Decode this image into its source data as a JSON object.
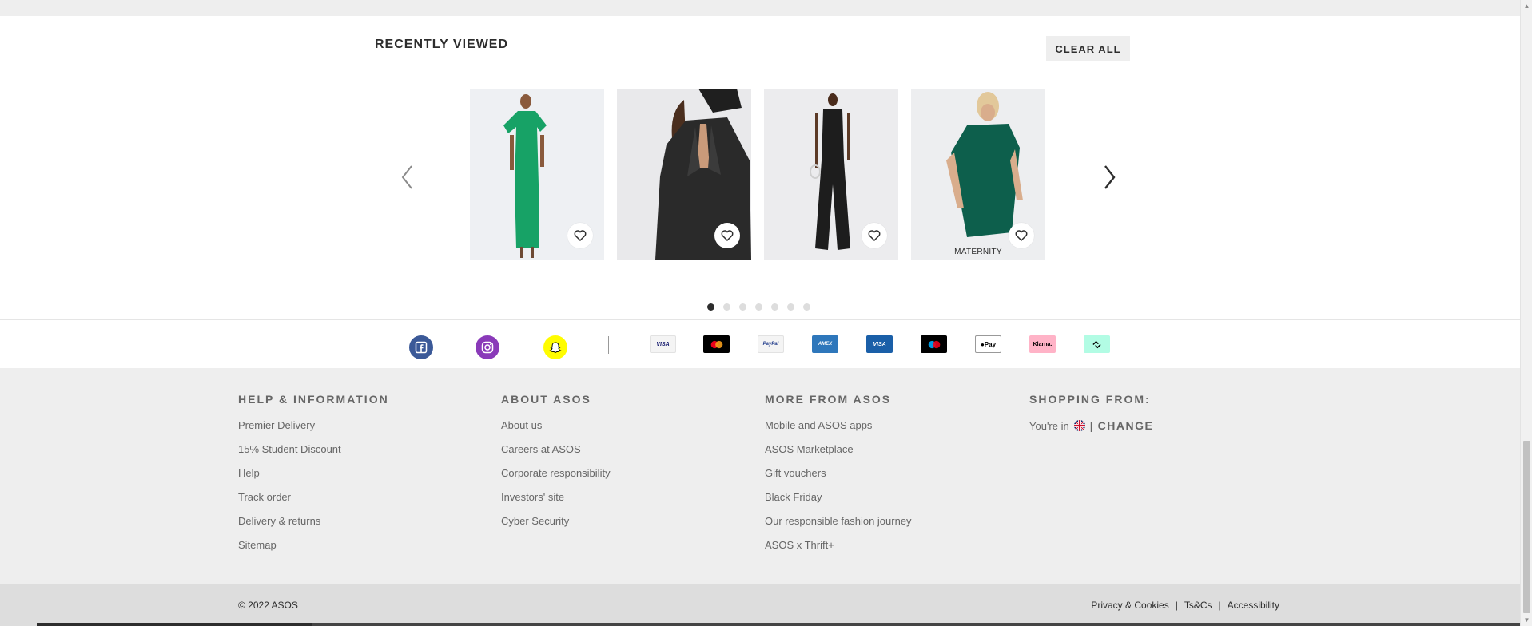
{
  "recently_viewed": {
    "title": "RECENTLY VIEWED",
    "clear_label": "CLEAR ALL",
    "products": [
      {
        "alt": "green dress",
        "badge": ""
      },
      {
        "alt": "black leather blazer",
        "badge": ""
      },
      {
        "alt": "black jumpsuit",
        "badge": ""
      },
      {
        "alt": "teal maternity dress",
        "badge": "MATERNITY"
      }
    ],
    "page_count": 7,
    "active_page": 1
  },
  "social": [
    {
      "icon": "facebook-icon",
      "color": "#3b5998"
    },
    {
      "icon": "instagram-icon",
      "color": "#8a3ab9"
    },
    {
      "icon": "snapchat-icon",
      "color": "#fffc00"
    }
  ],
  "payments": [
    {
      "icon": "visa-icon",
      "label": "VISA"
    },
    {
      "icon": "mastercard-icon",
      "label": ""
    },
    {
      "icon": "paypal-icon",
      "label": "PayPal"
    },
    {
      "icon": "amex-icon",
      "label": "AMEX"
    },
    {
      "icon": "visa-electron-icon",
      "label": "VISA"
    },
    {
      "icon": "maestro-icon",
      "label": ""
    },
    {
      "icon": "apple-pay-icon",
      "label": "Pay"
    },
    {
      "icon": "klarna-icon",
      "label": "Klarna."
    },
    {
      "icon": "clearpay-icon",
      "label": ""
    }
  ],
  "footer": {
    "help": {
      "title": "HELP & INFORMATION",
      "links": [
        "Premier Delivery",
        "15% Student Discount",
        "Help",
        "Track order",
        "Delivery & returns",
        "Sitemap"
      ]
    },
    "about": {
      "title": "ABOUT ASOS",
      "links": [
        "About us",
        "Careers at ASOS",
        "Corporate responsibility",
        "Investors' site",
        "Cyber Security"
      ]
    },
    "more": {
      "title": "MORE FROM ASOS",
      "links": [
        "Mobile and ASOS apps",
        "ASOS Marketplace",
        "Gift vouchers",
        "Black Friday",
        "Our responsible fashion journey",
        "ASOS x Thrift+"
      ]
    },
    "shopping": {
      "title": "SHOPPING FROM:",
      "youre_in": "You're in",
      "separator": "|",
      "change": "CHANGE"
    }
  },
  "bottom": {
    "copyright": "© 2022 ASOS",
    "links": [
      "Privacy & Cookies",
      "Ts&Cs",
      "Accessibility"
    ],
    "separator": "|"
  },
  "colors": {
    "accent": "#2d2d2d",
    "footer_bg": "#eeeeee",
    "bottom_bg": "#dddddd"
  }
}
